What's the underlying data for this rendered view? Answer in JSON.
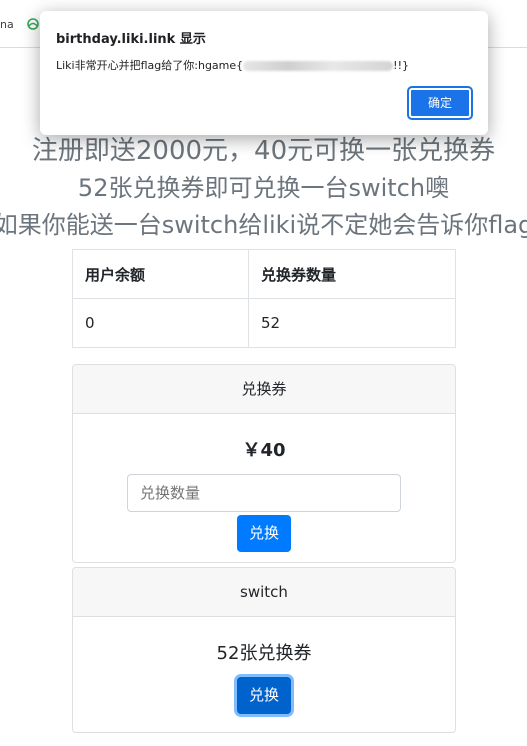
{
  "browser": {
    "bookmark_text": "na"
  },
  "page": {
    "line1": "注册即送2000元，40元可换一张兑换券",
    "line2": "52张兑换券即可兑换一台switch噢",
    "line3": "如果你能送一台switch给liki说不定她会告诉你flag"
  },
  "table": {
    "headers": [
      "用户余额",
      "兑换券数量"
    ],
    "rows": [
      [
        "0",
        "52"
      ]
    ]
  },
  "voucher_card": {
    "header": "兑换券",
    "price": "￥40",
    "input_placeholder": "兑换数量",
    "button_label": "兑换"
  },
  "switch_card": {
    "header": "switch",
    "title": "52张兑换券",
    "button_label": "兑换"
  },
  "dialog": {
    "title": "birthday.liki.link 显示",
    "message_prefix": "Liki非常开心并把flag给了你:hgame{",
    "message_suffix": "!!}",
    "ok_label": "确定"
  },
  "colors": {
    "primary": "#007bff",
    "muted_text": "#6c757d",
    "dialog_button": "#1a73e8"
  }
}
